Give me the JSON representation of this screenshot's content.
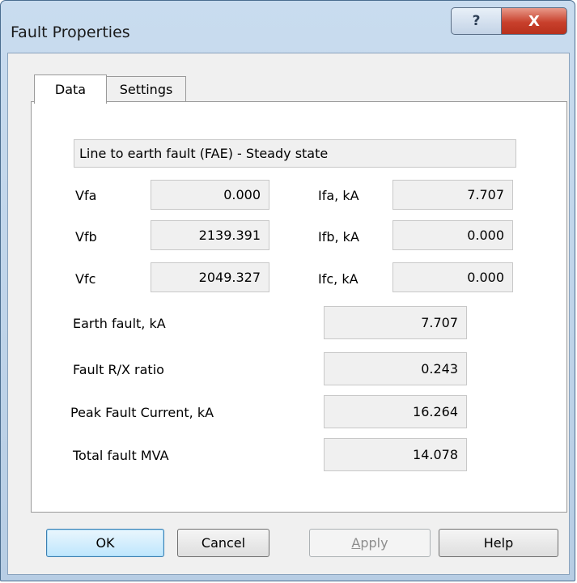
{
  "window": {
    "title": "Fault Properties",
    "help_button": "?",
    "close_button": "X"
  },
  "tabs": [
    {
      "label": "Data",
      "active": true
    },
    {
      "label": "Settings",
      "active": false
    }
  ],
  "fault_type": "Line to earth fault (FAE) - Steady state",
  "voltages": [
    {
      "label": "Vfa",
      "value": "0.000"
    },
    {
      "label": "Vfb",
      "value": "2139.391"
    },
    {
      "label": "Vfc",
      "value": "2049.327"
    }
  ],
  "currents": [
    {
      "label": "Ifa, kA",
      "value": "7.707"
    },
    {
      "label": "Ifb, kA",
      "value": "0.000"
    },
    {
      "label": "Ifc, kA",
      "value": "0.000"
    }
  ],
  "results": [
    {
      "label": "Earth fault, kA",
      "value": "7.707"
    },
    {
      "label": "Fault R/X ratio",
      "value": "0.243"
    },
    {
      "label": "Peak Fault Current, kA",
      "value": "16.264"
    },
    {
      "label": "Total fault MVA",
      "value": "14.078"
    }
  ],
  "buttons": {
    "ok": "OK",
    "cancel": "Cancel",
    "apply_accel": "A",
    "apply_rest": "pply",
    "apply_enabled": false,
    "help": "Help"
  }
}
